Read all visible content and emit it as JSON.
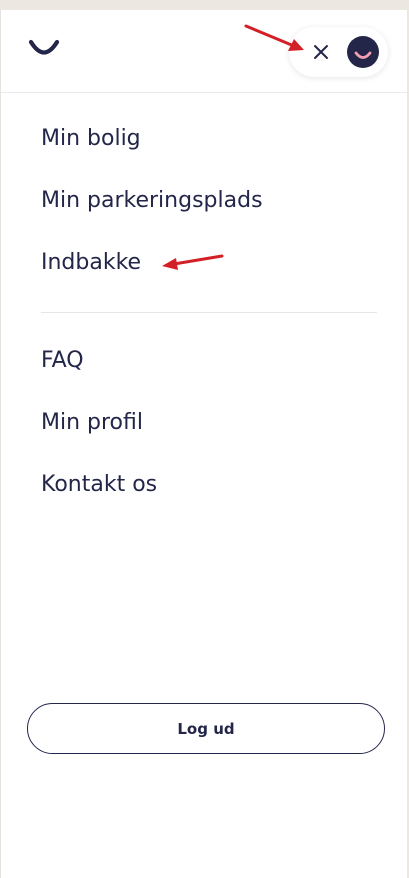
{
  "header": {
    "logo_icon": "smile-logo-icon",
    "close_icon": "close-icon",
    "avatar_icon": "smiley-avatar-icon"
  },
  "menu": {
    "primary_items": [
      {
        "label": "Min bolig"
      },
      {
        "label": "Min parkeringsplads"
      },
      {
        "label": "Indbakke"
      }
    ],
    "secondary_items": [
      {
        "label": "FAQ"
      },
      {
        "label": "Min profil"
      },
      {
        "label": "Kontakt os"
      }
    ]
  },
  "logout": {
    "label": "Log ud"
  },
  "annotations": {
    "arrow_color": "#d32027"
  },
  "colors": {
    "brand": "#232649",
    "avatar_smile": "#f2a0b0",
    "background": "#ece7e1"
  }
}
